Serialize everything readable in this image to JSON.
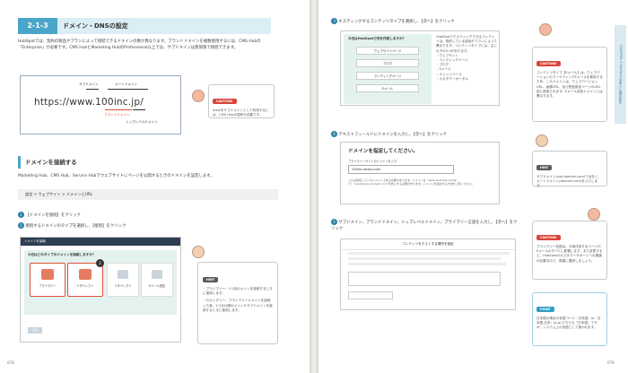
{
  "left": {
    "section_number": "2-1-3",
    "section_title": "ドメイン・DNSの設定",
    "intro": "HubSpotでは、契約の製品やプランによって接続できるドメインの数が異なります。ブランドドメインを複数使用するには、CMS Hubの「Enterprise」が必要です。CMS HubとMarketing HubのProfessional以上では、サブドメインは無制限で接続できます。",
    "url_label_sub": "サブドメイン",
    "url_label_root": "ルートドメイン",
    "url": "https://www.100inc.jp/",
    "url_label_brand": "ブランドドメイン",
    "url_label_tld": "トップレベルドメイン",
    "caution_tag": "CAUTION!",
    "caution_text": "wwwをサブドメインとして利用するには、CMS Hubの契約が必要です。",
    "sub_heading": "ドメインを接続する",
    "sub_intro": "Marketing Hub、CMS Hub、Service Hubでウェブサイトにページを公開するときのドメインを設定します。",
    "breadcrumb": "設定 > ウェブサイト > ドメインとURL",
    "step1_num": "1",
    "step1": "【ドメインを接続】をクリック",
    "step2_num": "2",
    "step2": "接続するドメインのタイプを選択し、【接続】をクリック",
    "shot_header": "ドメインを接続",
    "shot_question": "今日はどのタイプのドメインを接続しますか？",
    "shot_cards": [
      "プライマリー",
      "リダイレクト",
      "リダイレクト",
      "Eメール送信"
    ],
    "shot_badge": "2",
    "shot_connect": "接続",
    "hint_tag": "HINT",
    "hint_items": [
      "・プライマリー：1つ目のメインを接続するときに使用します。",
      "・セカンダリー：プライマリードメインを接続した後、2つ目以降のメインやサブドメインを接続するときに使用します。"
    ],
    "page_number": "078"
  },
  "right": {
    "step3_num": "3",
    "step3": "ホスティングするコンテンツタイプを選択し、【次へ】をクリック",
    "shot3_title": "今日はHubSpotで何を作成しますか？",
    "shot3_options": [
      "ウェブサイトページ",
      "ブログ",
      "ランディングページ",
      "Eメール"
    ],
    "shot3_side": "HubSpotでホスティングできるコンテンツは、契約している製品やプランによって異なります。コンテンツタイプには、主に以下の5つがあります。",
    "shot3_list": [
      "・ウェブサイト",
      "・ランディングページ",
      "・ブログ",
      "・Eメール",
      "・ナレッジベース",
      "・カスタマーポータル"
    ],
    "caution1_tag": "CAUTION!",
    "caution1_text": "コンテンツタイプ【Eメール】は、ウェブバージョンのマーケティングEメールを使用するため、このドメインは、ウェブバージョンURL、画像URL、及び配信設定ページのURL用に使用されます。Eメール送信ドメインとは異なります。",
    "step4_num": "4",
    "step4": "テキストフィールドにドメインを入力し、【次へ】をクリック",
    "shot4_title": "ドメインを指定してください。",
    "shot4_label": "ブライマリーサイトのドメインを入力",
    "shot4_value": "100inc.demo.com",
    "shot4_note": "これは接続しているドメインである必要があります。ドメインは（www.example.comなど）\"subdomain.domain.com\"形式にする必要があります。ドメインを接続する方法をご覧ください。",
    "hint_tag": "HINT",
    "hint_text": "サブドメイン(sub.domain.com)ではなく、ルートドメイン(domain.com)を入力します。",
    "step5_num": "5",
    "step5": "サブドメイン、ブランドドメイン、トップレベルドメイン、プライマリー言語を入力し、【次へ】をクリック",
    "shot5_title": "コンテンツをホストする場所を指定",
    "caution2_tag": "CAUTION!",
    "caution2_text": "プライマリー言語は、今後作成するページやEメールのすべてに影響します。また変更すると、HubSpotのカスタマーサポートへの連絡が必要なので、慎重に選択しましょう。",
    "point_tag": "POINT",
    "point_text": "日本語の場合の言語コード・日本語：ja・日本語-日本：ja-jp どちらも「日本語」ですが、システム上の言語として扱われます。",
    "chapter_tab": "CHAPTER 2 HubSpotの導入と基本設定",
    "page_number": "079"
  }
}
